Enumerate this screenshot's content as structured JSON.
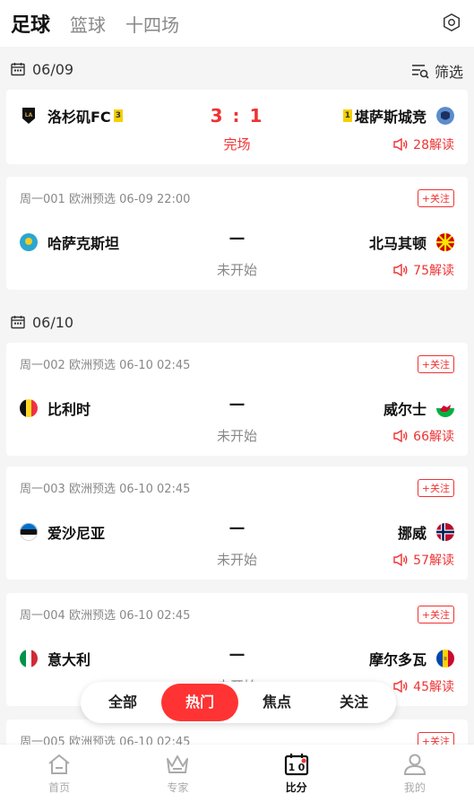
{
  "topnav": {
    "tabs": [
      {
        "label": "足球",
        "active": true
      },
      {
        "label": "篮球",
        "active": false
      },
      {
        "label": "十四场",
        "active": false
      }
    ]
  },
  "groups": [
    {
      "date": "06/09",
      "filter_label": "筛选"
    },
    {
      "date": "06/10"
    }
  ],
  "finished_match": {
    "home": "洛杉矶FC",
    "home_rank": "3",
    "away": "堪萨斯城竞",
    "away_rank": "1",
    "score": "3 : 1",
    "status": "完场",
    "analysis": "28解读"
  },
  "matches": [
    {
      "meta": "周一001 欧洲预选 06-09 22:00",
      "follow": "+关注",
      "home": "哈萨克斯坦",
      "away": "北马其顿",
      "vs": "—",
      "status": "未开始",
      "analysis": "75解读"
    },
    {
      "meta": "周一002 欧洲预选 06-10 02:45",
      "follow": "+关注",
      "home": "比利时",
      "away": "威尔士",
      "vs": "—",
      "status": "未开始",
      "analysis": "66解读"
    },
    {
      "meta": "周一003 欧洲预选 06-10 02:45",
      "follow": "+关注",
      "home": "爱沙尼亚",
      "away": "挪威",
      "vs": "—",
      "status": "未开始",
      "analysis": "57解读"
    },
    {
      "meta": "周一004 欧洲预选 06-10 02:45",
      "follow": "+关注",
      "home": "意大利",
      "away": "摩尔多瓦",
      "vs": "—",
      "status": "未开始",
      "analysis": "45解读"
    },
    {
      "meta": "周一005 欧洲预选 06-10 02:45",
      "follow": "+关注"
    }
  ],
  "pill_filter": {
    "items": [
      {
        "label": "全部",
        "active": false
      },
      {
        "label": "热门",
        "active": true
      },
      {
        "label": "焦点",
        "active": false
      },
      {
        "label": "关注",
        "active": false
      }
    ]
  },
  "bottombar": {
    "items": [
      {
        "label": "首页",
        "icon": "home-icon",
        "active": false
      },
      {
        "label": "专家",
        "icon": "crown-icon",
        "active": false
      },
      {
        "label": "比分",
        "icon": "scoreboard-icon",
        "active": true
      },
      {
        "label": "我的",
        "icon": "user-icon",
        "active": false
      }
    ]
  },
  "colors": {
    "accent": "#ee3333",
    "rank_badge": "#f5d000"
  }
}
